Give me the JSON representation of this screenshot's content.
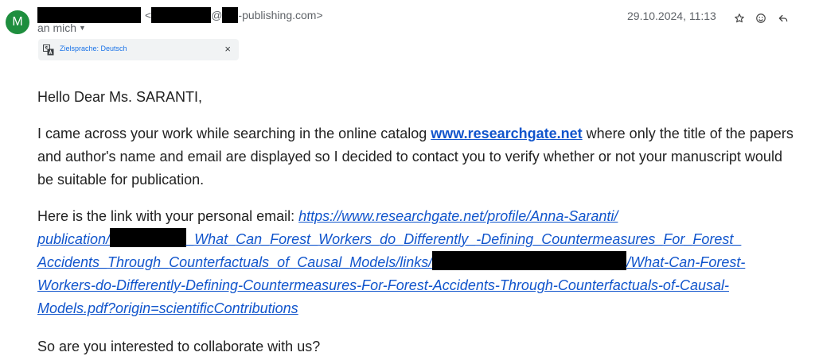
{
  "header": {
    "avatar_letter": "M",
    "sender_email_open": "<",
    "sender_email_at": "@",
    "sender_email_domain": "-publishing.com>",
    "recipient": "an mich",
    "date": "29.10.2024, 11:13",
    "icons": [
      "star-icon",
      "emoji-icon",
      "reply-icon"
    ]
  },
  "translate_bar": {
    "label": "Zielsprache: Deutsch",
    "close": "×"
  },
  "body": {
    "greeting": "Hello Dear Ms. SARANTI,",
    "p1_before": "I came across your work while searching in the online catalog ",
    "p1_link": "www.researchgate.net",
    "p1_after": " where only the title of the papers and author's name and email are displayed so I decided to contact you to verify whether or not your manuscript would be suitable for publication.",
    "p2_before": "Here is the link with your personal email: ",
    "p2_link_1": "https://www.researchgate.net/profile/Anna-Saranti/",
    "p2_link_2": "publication/",
    "p2_link_3": "_What_Can_Forest_Workers_do_Differently_-Defining_Countermeasures_For_Forest_",
    "p2_link_4": "Accidents_Through_Counterfactuals_of_Causal_Models/links/",
    "p2_link_5": "/What-Can-Forest-",
    "p2_link_6": "Workers-do-Differently-Defining-Countermeasures-For-Forest-Accidents-Through-Counterfactuals-of-Causal-",
    "p2_link_7": "Models.pdf?origin=scientificContributions",
    "p3": "So are you interested to collaborate with us?"
  }
}
